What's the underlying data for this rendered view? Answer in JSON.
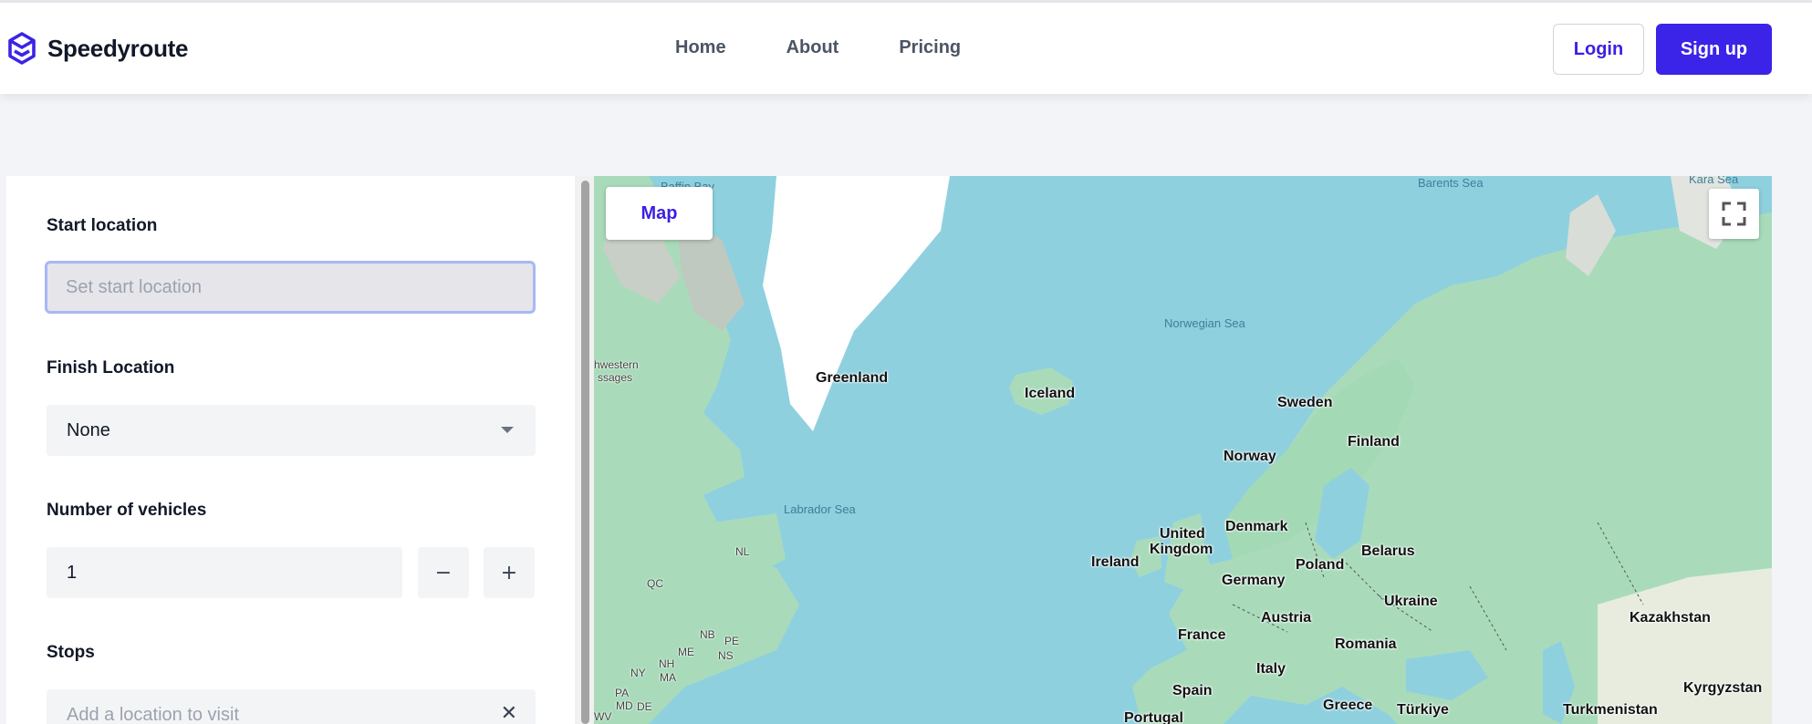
{
  "brand": {
    "name": "Speedyroute",
    "logo_icon": "layers-logo-icon",
    "accent": "#3b23e8"
  },
  "nav": {
    "items": [
      {
        "label": "Home"
      },
      {
        "label": "About"
      },
      {
        "label": "Pricing"
      }
    ]
  },
  "auth": {
    "login_label": "Login",
    "signup_label": "Sign up"
  },
  "form": {
    "start": {
      "label": "Start location",
      "placeholder": "Set start location",
      "value": ""
    },
    "finish": {
      "label": "Finish Location",
      "selected": "None"
    },
    "vehicles": {
      "label": "Number of vehicles",
      "value": "1",
      "decrement": "−",
      "increment": "+"
    },
    "stops": {
      "label": "Stops",
      "placeholder": "Add a location to visit",
      "clear": "✕"
    }
  },
  "map": {
    "tab_label": "Map",
    "fullscreen_icon": "fullscreen-icon",
    "seas": [
      "Baffin Bay",
      "Barents Sea",
      "Kara Sea",
      "Norwegian Sea",
      "Labrador Sea"
    ],
    "countries": [
      "Greenland",
      "Iceland",
      "Sweden",
      "Finland",
      "Norway",
      "Denmark",
      "United",
      "Kingdom",
      "Ireland",
      "Belarus",
      "Poland",
      "Germany",
      "Ukraine",
      "Austria",
      "France",
      "Romania",
      "Kazakhstan",
      "Italy",
      "Spain",
      "Greece",
      "Türkiye",
      "Turkmenistan",
      "Kyrgyzstan",
      "Portugal"
    ],
    "small": [
      "hwestern",
      "ssages",
      "QC",
      "NL",
      "NB",
      "PE",
      "NS",
      "ME",
      "NH",
      "MA",
      "NY",
      "PA",
      "MD",
      "DE",
      "WV"
    ]
  }
}
